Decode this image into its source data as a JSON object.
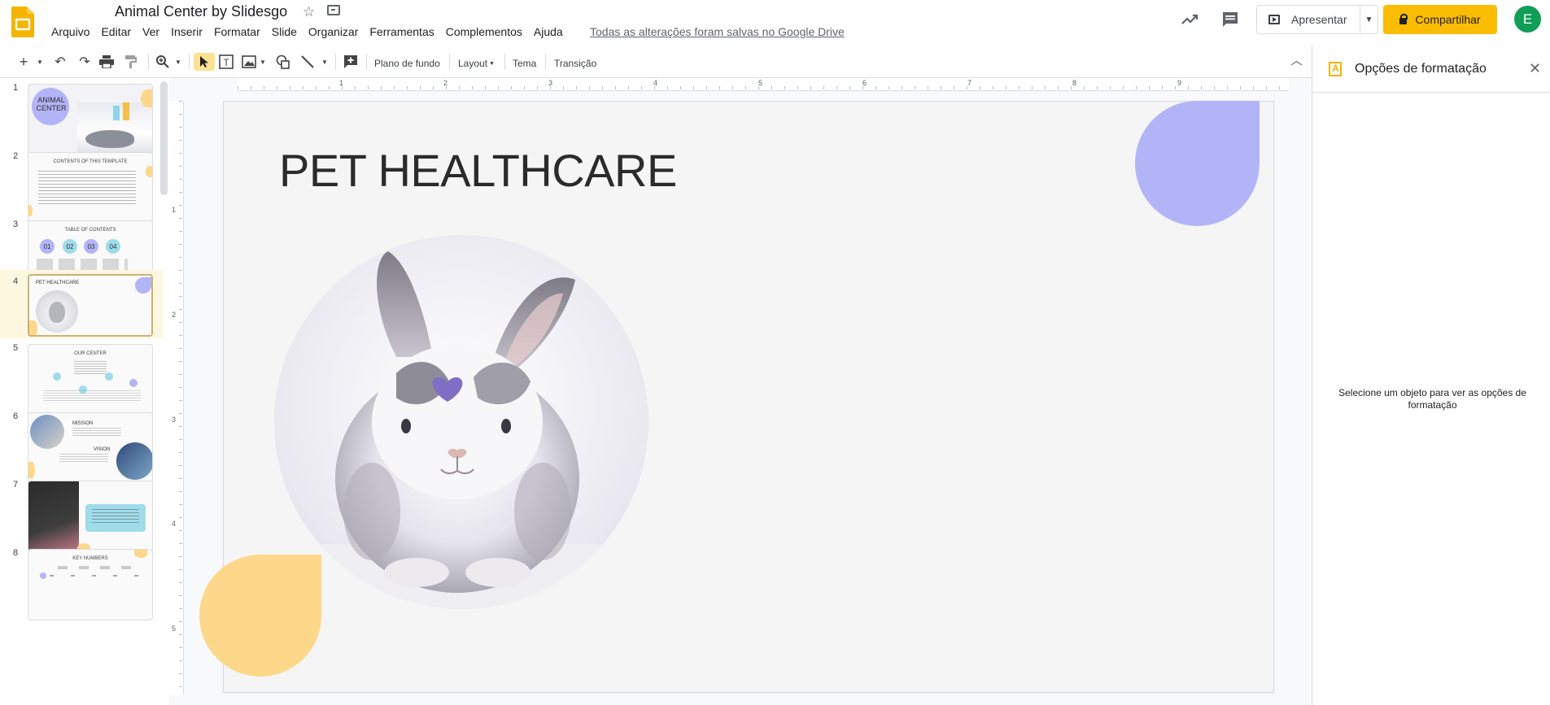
{
  "header": {
    "title": "Animal Center by Slidesgo",
    "menu": [
      "Arquivo",
      "Editar",
      "Ver",
      "Inserir",
      "Formatar",
      "Slide",
      "Organizar",
      "Ferramentas",
      "Complementos",
      "Ajuda"
    ],
    "saved_status": "Todas as alterações foram salvas no Google Drive",
    "present_label": "Apresentar",
    "share_label": "Compartilhar",
    "avatar_initial": "E"
  },
  "toolbar": {
    "background_label": "Plano de fundo",
    "layout_label": "Layout",
    "theme_label": "Tema",
    "transition_label": "Transição"
  },
  "filmstrip": {
    "slides": [
      {
        "num": "1",
        "title": "ANIMAL CENTER"
      },
      {
        "num": "2",
        "title": "CONTENTS OF THIS TEMPLATE"
      },
      {
        "num": "3",
        "title": "TABLE OF CONTENTS"
      },
      {
        "num": "4",
        "title": "PET HEALTHCARE"
      },
      {
        "num": "5",
        "title": "OUR CENTER"
      },
      {
        "num": "6",
        "title": "MISSION"
      },
      {
        "num": "7",
        "title": ""
      },
      {
        "num": "8",
        "title": "KEY NUMBERS"
      }
    ],
    "toc_numbers": [
      "01",
      "02",
      "03",
      "04"
    ],
    "vision_label": "VISION"
  },
  "ruler": {
    "h": [
      "1",
      "2",
      "3",
      "4",
      "5",
      "6",
      "7",
      "8",
      "9"
    ],
    "v": [
      "1",
      "2",
      "3",
      "4",
      "5"
    ]
  },
  "slide": {
    "title": "PET HEALTHCARE"
  },
  "panel": {
    "title": "Opções de formatação",
    "message": "Selecione um objeto para ver as opções de formatação"
  },
  "colors": {
    "accent_yellow": "#fbbc04",
    "purple_blob": "#b3b4f8",
    "yellow_blob": "#fdd88a",
    "active_slide_bg": "#fef7e0"
  }
}
